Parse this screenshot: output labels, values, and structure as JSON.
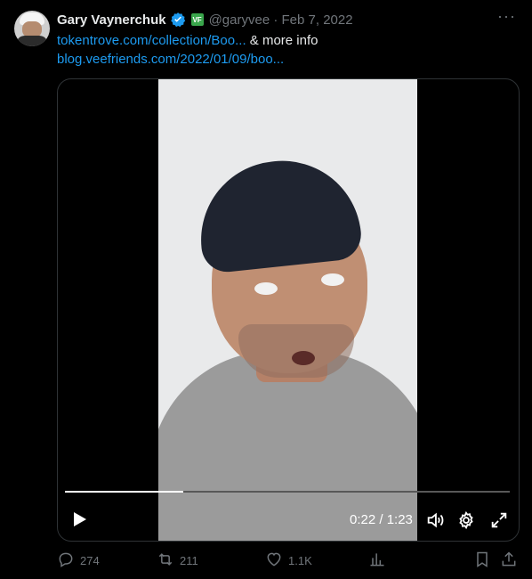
{
  "tweet": {
    "author_name": "Gary Vaynerchuk",
    "vf_badge": "VF",
    "handle_date": "@garyvee · Feb 7, 2022",
    "more_label": "···",
    "link1": "tokentrove.com/collection/Boo...",
    "link1_suffix": " & more info",
    "link2": "blog.veefriends.com/2022/01/09/boo..."
  },
  "video": {
    "time": "0:22 / 1:23",
    "progress": 0.265
  },
  "actions": {
    "replies": "274",
    "reposts": "211",
    "likes": "1.1K"
  },
  "icons": [
    "verified-icon",
    "vf-badge-icon",
    "more-icon",
    "play-icon",
    "volume-icon",
    "settings-icon",
    "fullscreen-icon",
    "reply-icon",
    "repost-icon",
    "like-icon",
    "analytics-icon",
    "bookmark-icon",
    "share-icon"
  ],
  "colors": {
    "link": "#1d9bf0",
    "muted": "#71767b",
    "verified": "#1d9bf0"
  }
}
